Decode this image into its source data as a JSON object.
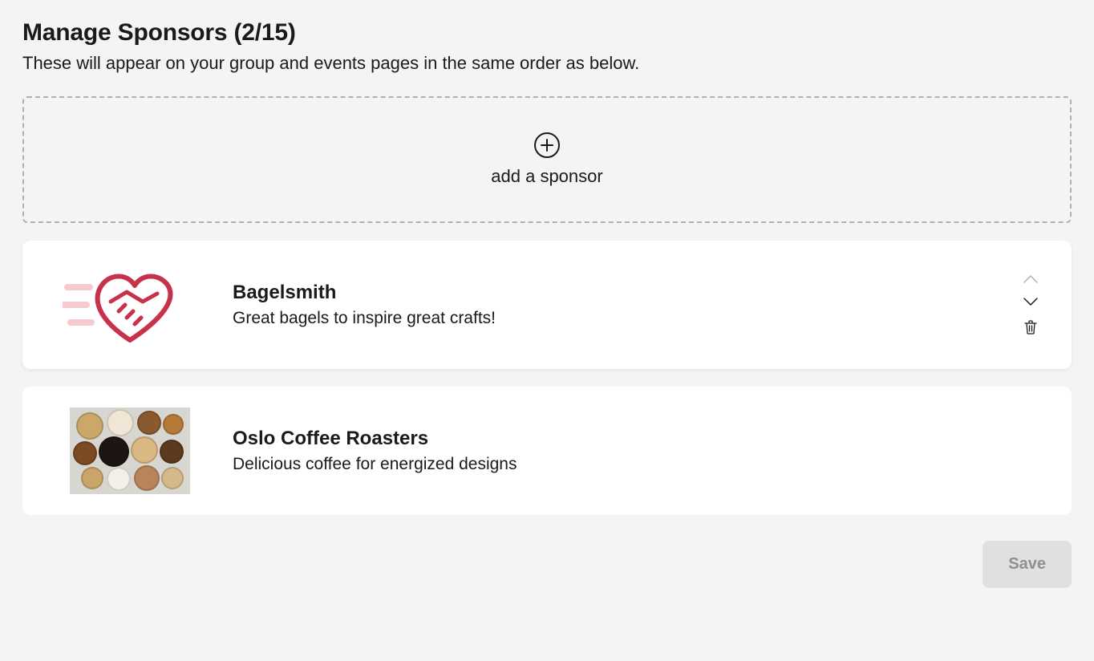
{
  "header": {
    "title": "Manage Sponsors (2/15)",
    "subtitle": "These will appear on your group and events pages in the same order as below."
  },
  "add_box": {
    "label": "add a sponsor"
  },
  "sponsors": [
    {
      "name": "Bagelsmith",
      "description": "Great bagels to inspire great crafts!",
      "logo": "handshake-heart-icon",
      "selected": true
    },
    {
      "name": "Oslo Coffee Roasters",
      "description": "Delicious coffee for energized designs",
      "logo": "coffee-cups-image",
      "selected": false
    }
  ],
  "actions": {
    "save_label": "Save"
  }
}
